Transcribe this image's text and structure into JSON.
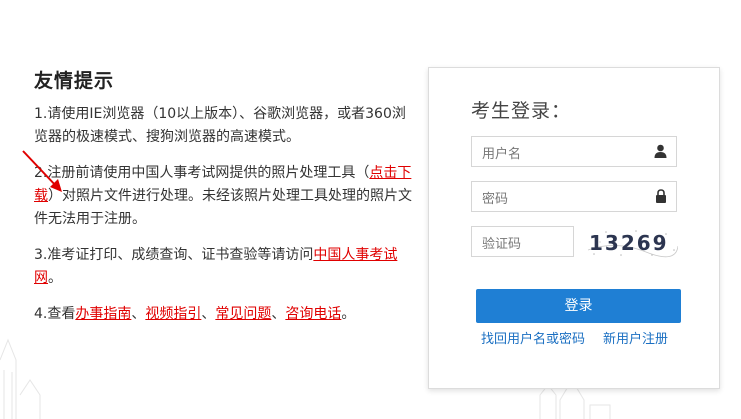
{
  "tips": {
    "title": "友情提示",
    "item1": "1.请使用IE浏览器（10以上版本）、谷歌浏览器，或者360浏览器的极速模式、搜狗浏览器的高速模式。",
    "item2_prefix": "2.注册前请使用中国人事考试网提供的照片处理工具（",
    "item2_link": "点击下载",
    "item2_suffix": "）对照片文件进行处理。未经该照片处理工具处理的照片文件无法用于注册。",
    "item3_prefix": "3.准考证打印、成绩查询、证书查验等请访问",
    "item3_link": "中国人事考试网",
    "item3_suffix": "。",
    "item4_prefix": "4.查看",
    "item4_links": [
      "办事指南",
      "视频指引",
      "常见问题",
      "咨询电话"
    ],
    "sep": "、",
    "item4_suffix": "。"
  },
  "login": {
    "title": "考生登录：",
    "username_placeholder": "用户名",
    "password_placeholder": "密码",
    "captcha_placeholder": "验证码",
    "captcha_text": "13269",
    "submit_label": "登录",
    "recover_link": "找回用户名或密码",
    "register_link": "新用户注册"
  },
  "colors": {
    "link_red": "#e00000",
    "button_blue": "#1f7fd4",
    "link_blue": "#1a6fc2"
  }
}
